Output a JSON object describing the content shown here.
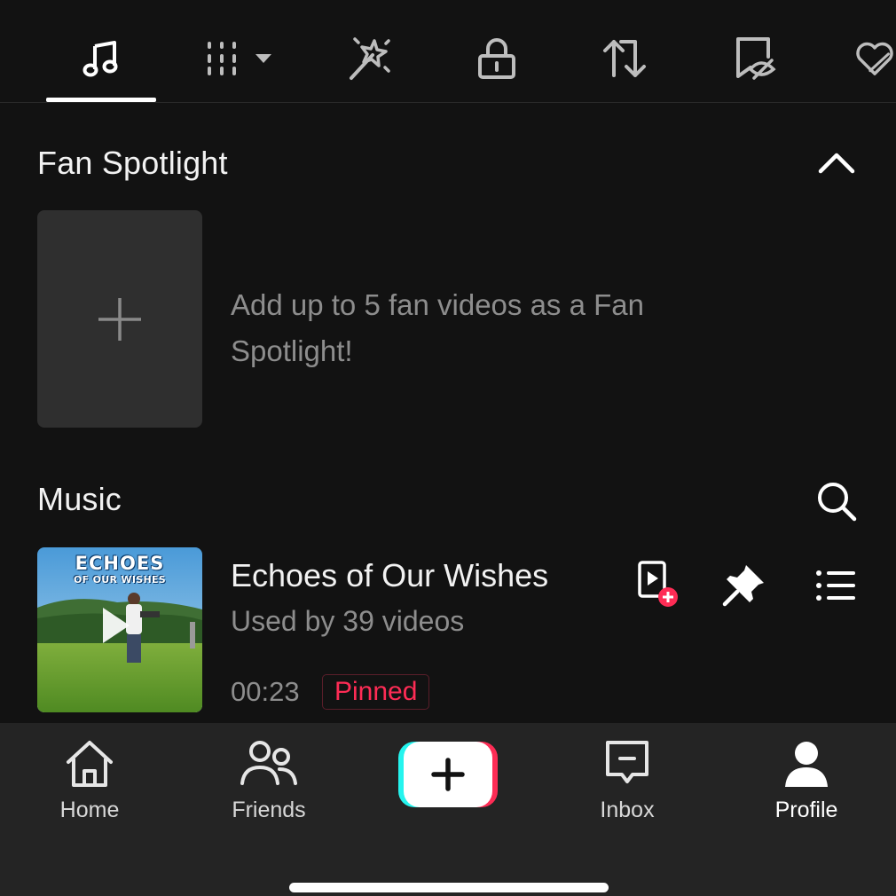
{
  "tabs": [
    {
      "icon": "music-note-icon",
      "active": true
    },
    {
      "icon": "playlist-dropdown-icon",
      "active": false
    },
    {
      "icon": "magic-wand-icon",
      "active": false
    },
    {
      "icon": "lock-icon",
      "active": false
    },
    {
      "icon": "repost-icon",
      "active": false
    },
    {
      "icon": "hidden-bookmark-icon",
      "active": false
    },
    {
      "icon": "hidden-heart-icon",
      "active": false
    }
  ],
  "fan_spotlight": {
    "title": "Fan Spotlight",
    "description": "Add up to 5 fan videos as a Fan Spotlight!"
  },
  "music": {
    "title": "Music",
    "song": {
      "cover_title": "ECHOES",
      "cover_subtitle": "OF OUR WISHES",
      "title": "Echoes of Our Wishes",
      "used_by": "Used by 39 videos",
      "duration": "00:23",
      "badge": "Pinned"
    }
  },
  "bottom_nav": {
    "home": "Home",
    "friends": "Friends",
    "inbox": "Inbox",
    "profile": "Profile"
  },
  "colors": {
    "accent": "#fe2c55",
    "background": "#121212",
    "nav_bg": "#242424",
    "cyan": "#25f4ee"
  }
}
